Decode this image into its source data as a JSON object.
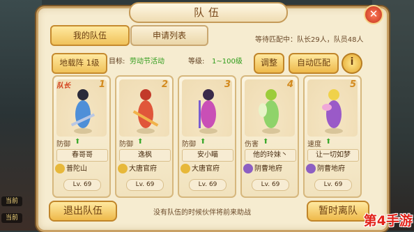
{
  "title": "队伍",
  "tabs": [
    {
      "label": "我的队伍"
    },
    {
      "label": "申请列表"
    }
  ],
  "queue_status": "等待匹配中：队长29人，队员48人",
  "controls": {
    "formation": "地载阵 1级",
    "goal_label": "目标:",
    "goal_value": "劳动节活动",
    "level_label": "等级:",
    "level_value": "1~100级",
    "adjust": "调整",
    "auto_match": "自动匹配",
    "help": "i"
  },
  "members": [
    {
      "slot": "1",
      "leader_tag": "队长",
      "role": "防御",
      "name": "春哥哥",
      "school": "普陀山",
      "level": "Lv. 69",
      "school_color": "#e7b83a"
    },
    {
      "slot": "2",
      "leader_tag": "",
      "role": "防御",
      "name": "逸枫",
      "school": "大唐官府",
      "level": "Lv. 69",
      "school_color": "#e7b83a"
    },
    {
      "slot": "3",
      "leader_tag": "",
      "role": "防御",
      "name": "安小瞄",
      "school": "大唐官府",
      "level": "Lv. 69",
      "school_color": "#e7b83a"
    },
    {
      "slot": "4",
      "leader_tag": "",
      "role": "伤害",
      "name": "他的玲妹丶",
      "school": "阴曹地府",
      "level": "Lv. 69",
      "school_color": "#8d5fc2"
    },
    {
      "slot": "5",
      "leader_tag": "",
      "role": "速度",
      "name": "让一切如梦",
      "school": "阴曹地府",
      "level": "Lv. 69",
      "school_color": "#8d5fc2"
    }
  ],
  "bottom": {
    "leave": "退出队伍",
    "hint": "没有队伍的时候伙伴将前来助战",
    "away": "暂时离队"
  },
  "side": {
    "chip1": "当前",
    "chip2": "当前"
  },
  "watermark": "第4手游"
}
